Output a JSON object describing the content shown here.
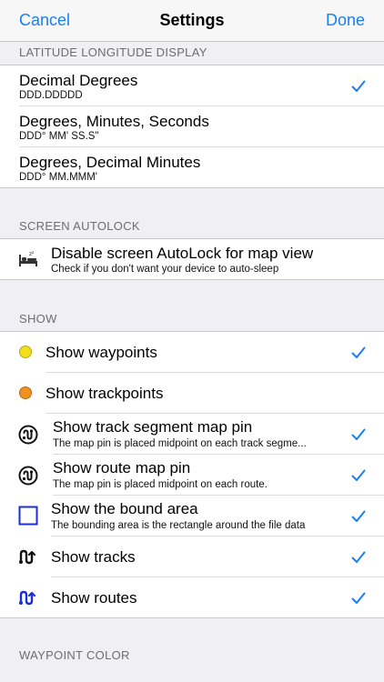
{
  "nav": {
    "cancel": "Cancel",
    "title": "Settings",
    "done": "Done"
  },
  "colors": {
    "accent": "#1a7ff0",
    "yellow_dot": "#f2e11a",
    "orange_dot": "#f0901e",
    "route_blue": "#1a2fd8"
  },
  "latlon": {
    "header": "LATITUDE LONGITUDE DISPLAY",
    "items": [
      {
        "title": "Decimal Degrees",
        "subtitle": "DDD.DDDDD",
        "checked": true
      },
      {
        "title": "Degrees, Minutes, Seconds",
        "subtitle": "DDD° MM' SS.S\"",
        "checked": false
      },
      {
        "title": "Degrees, Decimal Minutes",
        "subtitle": "DDD° MM.MMM'",
        "checked": false
      }
    ]
  },
  "autolock": {
    "header": "SCREEN AUTOLOCK",
    "title": "Disable screen AutoLock for map view",
    "subtitle": "Check if you don't want your device to auto-sleep",
    "icon": "bed-icon"
  },
  "show": {
    "header": "SHOW",
    "items": [
      {
        "title": "Show waypoints",
        "icon": "yellow-dot-icon",
        "checked": true
      },
      {
        "title": "Show trackpoints",
        "icon": "orange-dot-icon",
        "checked": false
      },
      {
        "title": "Show track segment map pin",
        "subtitle": "The map pin is placed midpoint on each track segme...",
        "icon": "track-pin-icon",
        "checked": true
      },
      {
        "title": "Show route map pin",
        "subtitle": "The map pin is placed midpoint on each route.",
        "icon": "route-pin-icon",
        "checked": true
      },
      {
        "title": "Show the bound area",
        "subtitle": "The bounding area is the rectangle around the file data",
        "icon": "bound-square-icon",
        "checked": true
      },
      {
        "title": "Show tracks",
        "icon": "tracks-icon",
        "checked": true
      },
      {
        "title": "Show routes",
        "icon": "routes-icon",
        "checked": true
      }
    ]
  },
  "waypoint_color": {
    "header": "WAYPOINT COLOR"
  }
}
